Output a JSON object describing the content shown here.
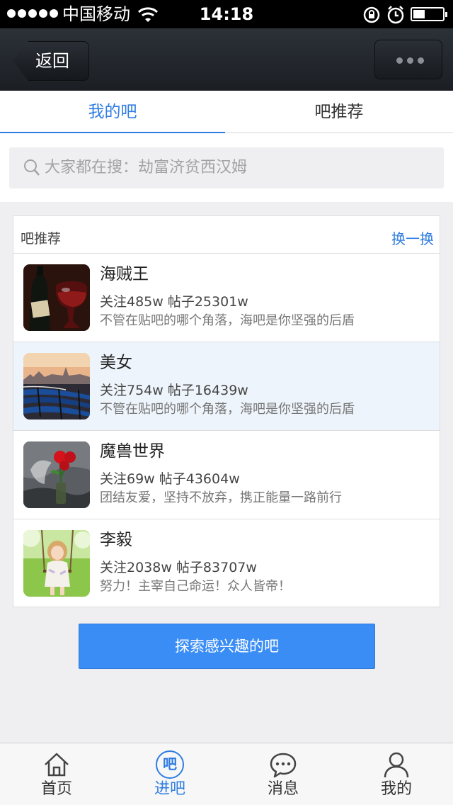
{
  "status_bar": {
    "carrier": "中国移动",
    "time": "14:18"
  },
  "nav": {
    "back_label": "返回"
  },
  "tabs": [
    {
      "label": "我的吧",
      "active": true
    },
    {
      "label": "吧推荐",
      "active": false
    }
  ],
  "search": {
    "placeholder": "大家都在搜：劫富济贫西汉姆"
  },
  "recommend": {
    "title": "吧推荐",
    "refresh_label": "换一换",
    "items": [
      {
        "name": "海贼王",
        "stats": "关注485w  帖子25301w",
        "desc": "不管在贴吧的哪个角落，海吧是你坚强的后盾"
      },
      {
        "name": "美女",
        "stats": "关注754w  帖子16439w",
        "desc": "不管在贴吧的哪个角落，海吧是你坚强的后盾"
      },
      {
        "name": "魔兽世界",
        "stats": "关注69w  帖子43604w",
        "desc": "团结友爱，坚持不放弃，携正能量一路前行"
      },
      {
        "name": "李毅",
        "stats": "关注2038w  帖子83707w",
        "desc": "努力！主宰自己命运！众人皆帝！"
      }
    ]
  },
  "explore_label": "探索感兴趣的吧",
  "tab_bar": [
    {
      "label": "首页",
      "icon": "home-icon"
    },
    {
      "label": "进吧",
      "icon": "ba-icon",
      "icon_text": "吧",
      "active": true
    },
    {
      "label": "消息",
      "icon": "message-icon"
    },
    {
      "label": "我的",
      "icon": "profile-icon"
    }
  ],
  "colors": {
    "accent": "#2f7de0",
    "button": "#3a8df5",
    "nav_bar": "#22272d",
    "highlight_row": "#eef4fb"
  }
}
